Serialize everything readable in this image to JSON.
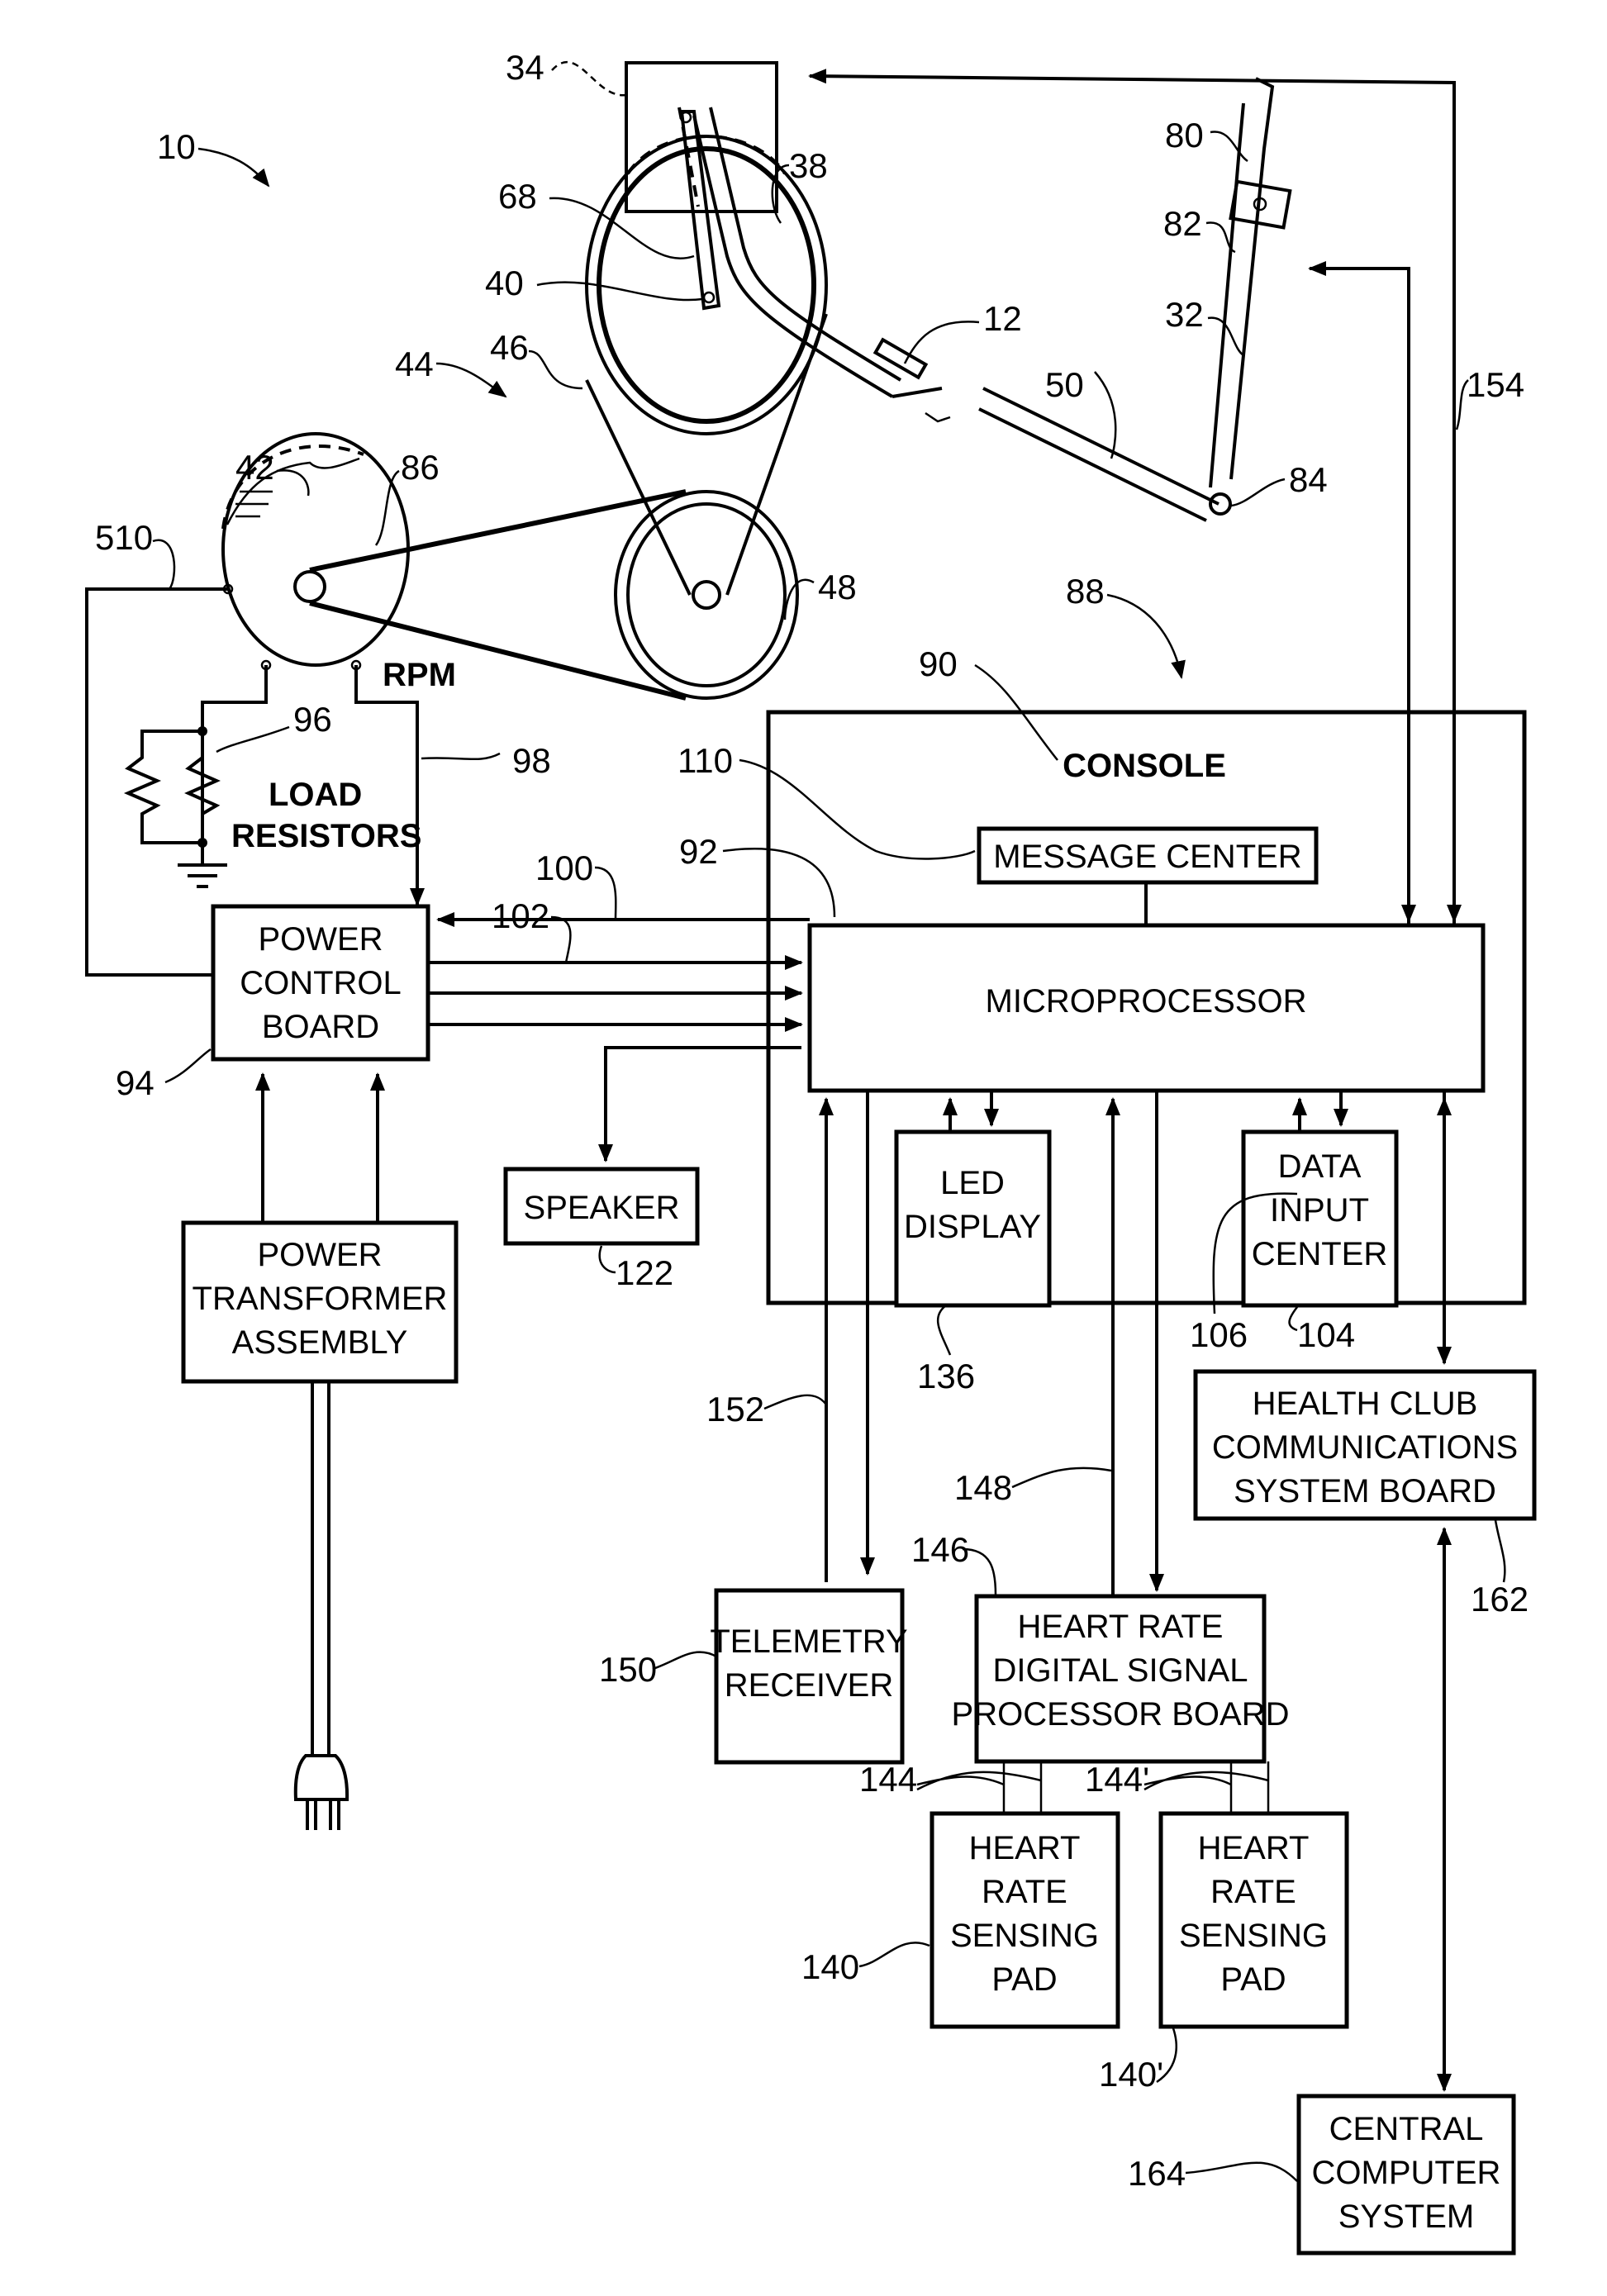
{
  "figure": {
    "title_ref": "10",
    "colors": {
      "line": "#000000",
      "background": "#ffffff"
    }
  },
  "blocks": {
    "console": "CONSOLE",
    "message_center": "MESSAGE CENTER",
    "microprocessor": "MICROPROCESSOR",
    "led_display": [
      "LED",
      "DISPLAY"
    ],
    "data_input_center": [
      "DATA",
      "INPUT",
      "CENTER"
    ],
    "power_control_board": [
      "POWER",
      "CONTROL",
      "BOARD"
    ],
    "speaker": "SPEAKER",
    "power_transformer": [
      "POWER",
      "TRANSFORMER",
      "ASSEMBLY"
    ],
    "telemetry_receiver": [
      "TELEMETRY",
      "RECEIVER"
    ],
    "hr_dsp_board": [
      "HEART RATE",
      "DIGITAL SIGNAL",
      "PROCESSOR BOARD"
    ],
    "hr_pad_1": [
      "HEART",
      "RATE",
      "SENSING",
      "PAD"
    ],
    "hr_pad_2": [
      "HEART",
      "RATE",
      "SENSING",
      "PAD"
    ],
    "health_club_board": [
      "HEALTH CLUB",
      "COMMUNICATIONS",
      "SYSTEM BOARD"
    ],
    "central_computer": [
      "CENTRAL",
      "COMPUTER",
      "SYSTEM"
    ],
    "load_resistors": [
      "LOAD",
      "RESISTORS"
    ],
    "rpm": "RPM"
  },
  "refs": {
    "r10": "10",
    "r34": "34",
    "r38": "38",
    "r68": "68",
    "r40": "40",
    "r46": "46",
    "r44": "44",
    "r12": "12",
    "r80": "80",
    "r82": "82",
    "r32": "32",
    "r50": "50",
    "r84": "84",
    "r154": "154",
    "r42": "42",
    "r86": "86",
    "r510": "510",
    "r48": "48",
    "r88": "88",
    "r90": "90",
    "r96": "96",
    "r98": "98",
    "r110": "110",
    "r92": "92",
    "r100": "100",
    "r102": "102",
    "r94": "94",
    "r122": "122",
    "r136": "136",
    "r106": "106",
    "r104": "104",
    "r152": "152",
    "r148": "148",
    "r146": "146",
    "r150": "150",
    "r162": "162",
    "r144": "144",
    "r144p": "144'",
    "r140": "140",
    "r140p": "140'",
    "r164": "164"
  }
}
